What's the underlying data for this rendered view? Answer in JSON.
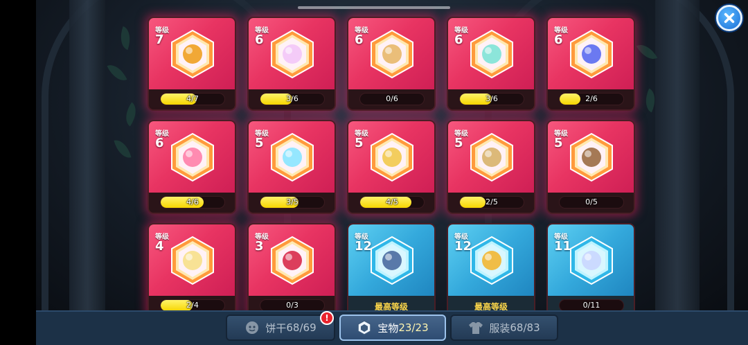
{
  "level_label": "等级",
  "max_level_label": "最高等级",
  "cards": [
    {
      "level": "7",
      "progress": "4/7",
      "ratio": 0.571,
      "style": "pink",
      "icon": "fire-crystal-icon",
      "accent": "#f0a020"
    },
    {
      "level": "6",
      "progress": "3/6",
      "ratio": 0.5,
      "style": "pink",
      "icon": "flower-cloud-icon",
      "accent": "#f3c6f7"
    },
    {
      "level": "6",
      "progress": "0/6",
      "ratio": 0,
      "style": "pink",
      "icon": "scroll-map-icon",
      "accent": "#e8b86a"
    },
    {
      "level": "6",
      "progress": "3/6",
      "ratio": 0.5,
      "style": "pink",
      "icon": "coral-branch-icon",
      "accent": "#7fe3d6"
    },
    {
      "level": "6",
      "progress": "2/6",
      "ratio": 0.333,
      "style": "pink",
      "icon": "blue-potion-icon",
      "accent": "#5b6cf0"
    },
    {
      "level": "6",
      "progress": "4/6",
      "ratio": 0.667,
      "style": "pink",
      "icon": "flamingo-ring-icon",
      "accent": "#ff7fa8"
    },
    {
      "level": "5",
      "progress": "3/5",
      "ratio": 0.6,
      "style": "pink",
      "icon": "cat-candy-icon",
      "accent": "#8ae6ff"
    },
    {
      "level": "5",
      "progress": "4/5",
      "ratio": 0.8,
      "style": "pink",
      "icon": "pocket-watch-icon",
      "accent": "#f2c94c"
    },
    {
      "level": "5",
      "progress": "2/5",
      "ratio": 0.4,
      "style": "pink",
      "icon": "bandaged-idol-icon",
      "accent": "#d8b36a"
    },
    {
      "level": "5",
      "progress": "0/5",
      "ratio": 0,
      "style": "pink",
      "icon": "acorn-pouch-icon",
      "accent": "#9b6b43"
    },
    {
      "level": "4",
      "progress": "2/4",
      "ratio": 0.5,
      "style": "pink",
      "icon": "flower-wreath-icon",
      "accent": "#f7e08a"
    },
    {
      "level": "3",
      "progress": "0/3",
      "ratio": 0,
      "style": "pink",
      "icon": "berries-icon",
      "accent": "#d82a4a"
    },
    {
      "level": "12",
      "progress": "",
      "ratio": 1,
      "style": "blue",
      "max": true,
      "icon": "dark-crown-icon",
      "accent": "#4a6aa0"
    },
    {
      "level": "12",
      "progress": "",
      "ratio": 1,
      "style": "blue",
      "max": true,
      "icon": "gold-pendant-icon",
      "accent": "#f2b632"
    },
    {
      "level": "11",
      "progress": "0/11",
      "ratio": 0,
      "style": "blue",
      "icon": "ghost-orb-icon",
      "accent": "#c9d6ff"
    }
  ],
  "tabs": [
    {
      "label": "饼干",
      "count": "68/69",
      "icon": "cookie-face-icon",
      "active": false,
      "badge": "!"
    },
    {
      "label": "宝物",
      "count": "23/23",
      "icon": "treasure-hex-icon",
      "active": true
    },
    {
      "label": "服装",
      "count": "68/83",
      "icon": "shirt-icon",
      "active": false
    }
  ],
  "colors": {
    "pink_card": "#e83462",
    "blue_card": "#34a9dc",
    "bar_fill": "#f7d600",
    "tabbar": "#1c3147"
  }
}
